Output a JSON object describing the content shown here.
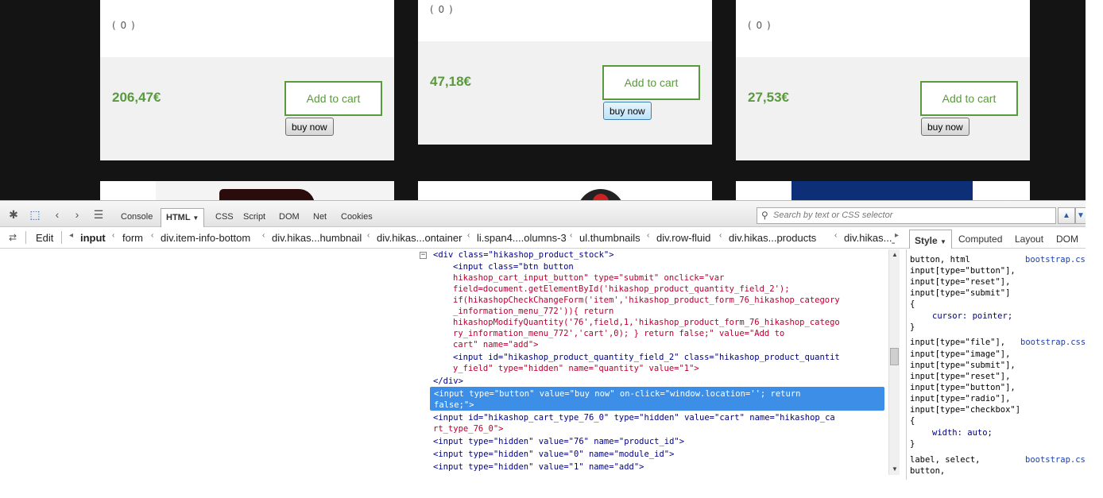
{
  "products": [
    {
      "rating": "( 0 )",
      "price": "206,47€",
      "add_to_cart": "Add to cart",
      "buy_now": "buy now"
    },
    {
      "rating": "( 0 )",
      "price": "47,18€",
      "add_to_cart": "Add to cart",
      "buy_now": "buy now"
    },
    {
      "rating": "( 0 )",
      "price": "27,53€",
      "add_to_cart": "Add to cart",
      "buy_now": "buy now"
    }
  ],
  "firebug": {
    "tabs": [
      "Console",
      "HTML",
      "CSS",
      "Script",
      "DOM",
      "Net",
      "Cookies"
    ],
    "active_tab": "HTML",
    "search_placeholder": "Search by text or CSS selector",
    "edit_label": "Edit",
    "breadcrumbs": [
      "input",
      "form",
      "div.item-info-bottom",
      "div.hikas...humbnail",
      "div.hikas...ontainer",
      "li.span4....olumns-3",
      "ul.thumbnails",
      "div.row-fluid",
      "div.hikas...products",
      "div.hikas..._lis"
    ],
    "side_tabs": [
      "Style",
      "Computed",
      "Layout",
      "DOM"
    ],
    "active_side_tab": "Style",
    "html_lines": [
      "<div class=\"hikashop_product_stock\">",
      "<input class=\"btn button",
      "hikashop_cart_input_button\" type=\"submit\" onclick=\"var",
      "field=document.getElementById('hikashop_product_quantity_field_2');",
      "if(hikashopCheckChangeForm('item','hikashop_product_form_76_hikashop_category",
      "_information_menu_772')){ return",
      "hikashopModifyQuantity('76',field,1,'hikashop_product_form_76_hikashop_catego",
      "ry_information_menu_772','cart',0); } return false;\" value=\"Add to",
      "cart\" name=\"add\">",
      "<input id=\"hikashop_product_quantity_field_2\" class=\"hikashop_product_quantit",
      "y_field\" type=\"hidden\" name=\"quantity\" value=\"1\">",
      "</div>",
      "<input type=\"button\" value=\"buy now\" on-click=\"window.location=''; return",
      "false;\">",
      "<input id=\"hikashop_cart_type_76_0\" type=\"hidden\" value=\"cart\" name=\"hikashop_ca",
      "rt_type_76_0\">",
      "<input type=\"hidden\" value=\"76\" name=\"product_id\">",
      "<input type=\"hidden\" value=\"0\" name=\"module_id\">",
      "<input type=\"hidden\" value=\"1\" name=\"add\">"
    ],
    "style_lines": [
      "button, html",
      "input[type=\"button\"],",
      "input[type=\"reset\"],",
      "input[type=\"submit\"]",
      "{",
      "cursor: pointer;",
      "}",
      "input[type=\"file\"],",
      "input[type=\"image\"],",
      "input[type=\"submit\"],",
      "input[type=\"reset\"],",
      "input[type=\"button\"],",
      "input[type=\"radio\"],",
      "input[type=\"checkbox\"]",
      "{",
      "width: auto;",
      "}",
      "label, select,",
      "button,"
    ],
    "style_sources": [
      "bootstrap.css",
      "bootstrap.css (",
      "bootstrap.css"
    ]
  }
}
